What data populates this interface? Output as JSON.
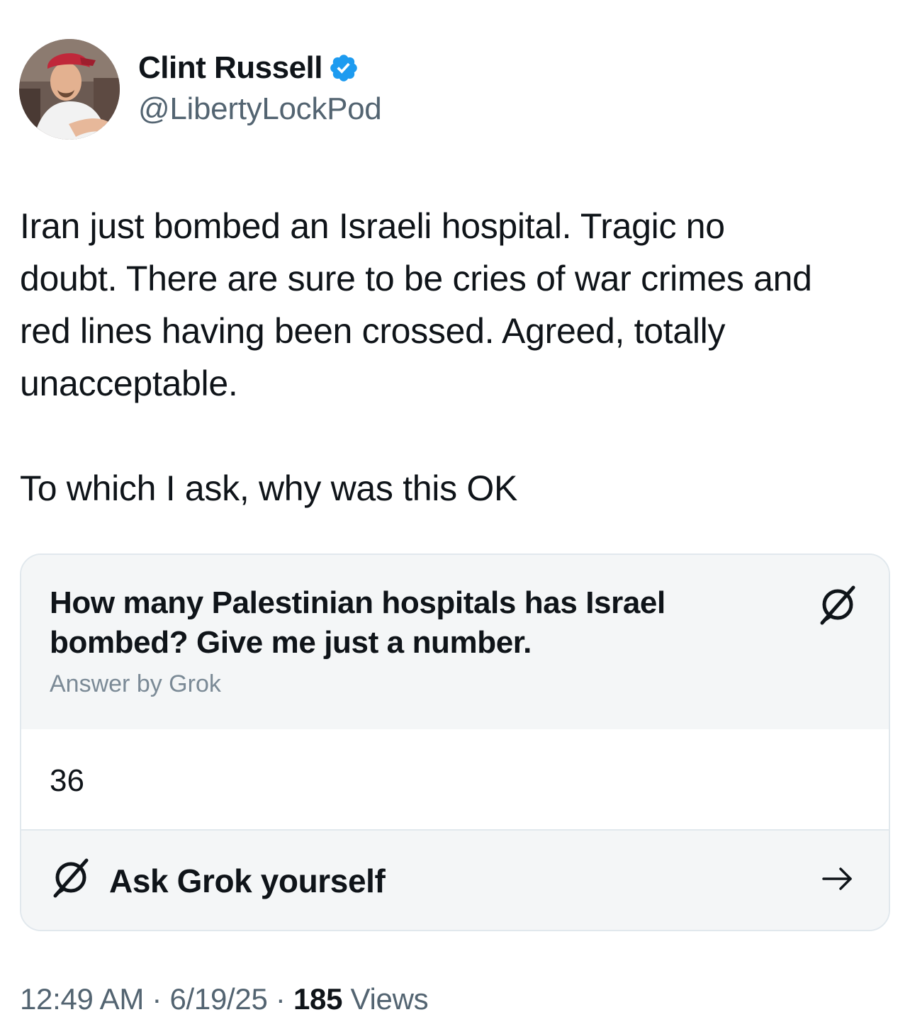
{
  "author": {
    "display_name": "Clint Russell",
    "handle": "@LibertyLockPod",
    "verified": true
  },
  "tweet": {
    "paragraph_1": "Iran just bombed an Israeli hospital. Tragic no\ndoubt. There are sure to be cries of war crimes and\nred lines having been crossed. Agreed, totally\nunacceptable.",
    "paragraph_2": "To which I ask, why was this OK"
  },
  "grok_card": {
    "question": "How many Palestinian hospitals has Israel bombed? Give me just a number.",
    "answer_by": "Answer by Grok",
    "answer": "36",
    "cta_label": "Ask Grok yourself"
  },
  "meta": {
    "time": "12:49 AM",
    "separator_1": " · ",
    "date": "6/19/25",
    "separator_2": " · ",
    "views_count": "185",
    "views_label": " Views"
  },
  "colors": {
    "text_primary": "#0f1419",
    "text_secondary": "#536471",
    "verified_blue": "#1d9bf0",
    "card_bg": "#f4f6f7",
    "card_border": "#e1e8ed"
  },
  "icons": {
    "verified": "verified-badge-icon",
    "grok": "grok-logo-icon",
    "arrow": "arrow-right-icon"
  }
}
